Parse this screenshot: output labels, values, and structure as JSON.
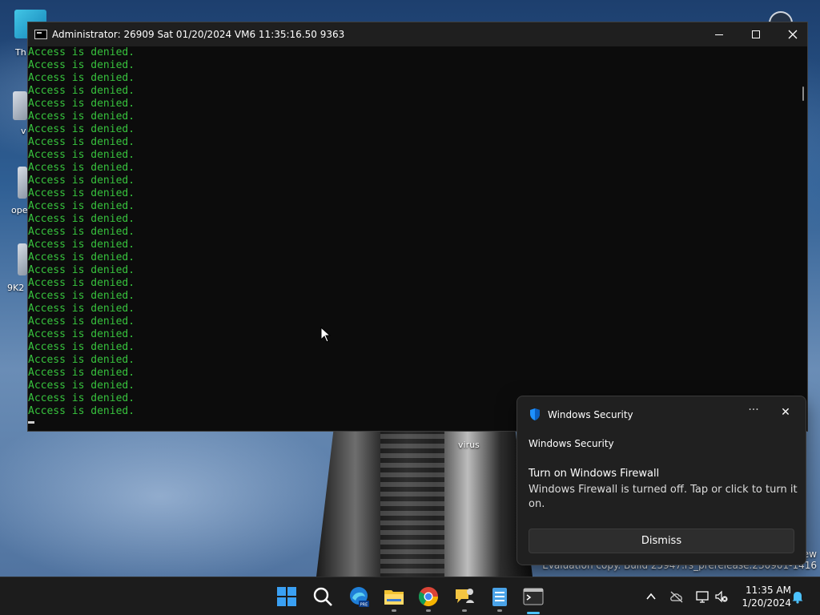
{
  "desktop": {
    "labels": {
      "icon1": "Th",
      "icon2": "v",
      "icon3": "ope",
      "icon4": "9K2"
    },
    "virus_label": "virus",
    "watermark_top": "ew",
    "watermark": "Evaluation copy. Build 25947.rs_prerelease.230901-1416"
  },
  "console": {
    "title": "Administrator:  26909 Sat 01/20/2024 VM6 11:35:16.50 9363",
    "output_line": "Access is denied.",
    "line_count": 29,
    "text_color": "#37c23d"
  },
  "toast": {
    "header": "Windows Security",
    "app_name": "Windows Security",
    "title": "Turn on Windows Firewall",
    "body": "Windows Firewall is turned off. Tap or click to turn it on.",
    "dismiss_label": "Dismiss",
    "more_label": "···",
    "close_label": "✕"
  },
  "taskbar": {
    "apps": [
      "start-icon",
      "search-icon",
      "edge-dev-icon",
      "file-explorer-icon",
      "chrome-icon",
      "feedback-hub-icon",
      "notepad-icon",
      "terminal-icon"
    ],
    "tray": [
      "chevron-up-icon",
      "cloud-offline-icon",
      "network-icon",
      "volume-muted-icon",
      "notification-bell-icon"
    ],
    "time": "11:35 AM",
    "date": "1/20/2024",
    "accent_color": "#4cc2ff"
  }
}
